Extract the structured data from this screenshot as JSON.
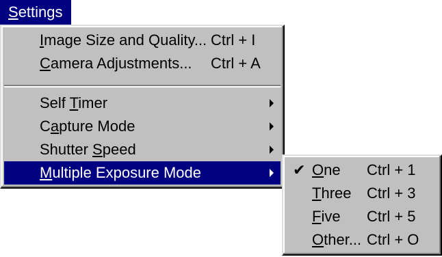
{
  "menu_title": {
    "mnemonic": "S",
    "rest": "ettings"
  },
  "dropdown": {
    "items": [
      {
        "pre": "",
        "mnemonic": "I",
        "post": "mage Size and Quality...",
        "shortcut": "Ctrl + I"
      },
      {
        "pre": "",
        "mnemonic": "C",
        "post": "amera Adjustments...",
        "shortcut": "Ctrl + A"
      },
      {
        "pre": "Self ",
        "mnemonic": "T",
        "post": "imer",
        "submenu": true
      },
      {
        "pre": "C",
        "mnemonic": "a",
        "post": "pture Mode",
        "submenu": true
      },
      {
        "pre": "Shutter ",
        "mnemonic": "S",
        "post": "peed",
        "submenu": true
      },
      {
        "pre": "",
        "mnemonic": "M",
        "post": "ultiple Exposure Mode",
        "submenu": true,
        "highlighted": true
      }
    ]
  },
  "submenu": {
    "items": [
      {
        "checked": true,
        "pre": "",
        "mnemonic": "O",
        "post": "ne",
        "shortcut": "Ctrl + 1"
      },
      {
        "checked": false,
        "pre": "",
        "mnemonic": "T",
        "post": "hree",
        "shortcut": "Ctrl + 3"
      },
      {
        "checked": false,
        "pre": "",
        "mnemonic": "F",
        "post": "ive",
        "shortcut": "Ctrl + 5"
      },
      {
        "checked": false,
        "pre": "",
        "mnemonic": "O",
        "post": "ther...",
        "shortcut": "Ctrl + O"
      }
    ],
    "check_glyph": "✔"
  },
  "colors": {
    "menu_bg": "#c0c0c0",
    "highlight": "#000080",
    "highlight_text": "#ffffff"
  }
}
